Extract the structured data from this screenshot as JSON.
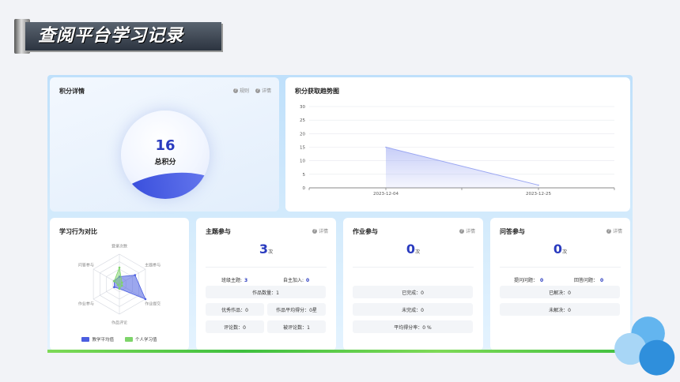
{
  "slide": {
    "title": "查阅平台学习记录"
  },
  "score_card": {
    "title": "积分详情",
    "rules_label": "规则",
    "details_label": "详情",
    "score": "16",
    "score_label": "总积分"
  },
  "trend_card": {
    "title": "积分获取趋势图"
  },
  "radar_card": {
    "title": "学习行为对比",
    "axes": [
      "登录次数",
      "主题参与",
      "作业提交",
      "作品评论",
      "作业参与",
      "问答参与"
    ],
    "legend": [
      {
        "name": "教学平均值",
        "color": "#4b5ee0"
      },
      {
        "name": "个人学习值",
        "color": "#7ed46a"
      }
    ],
    "colors": {
      "teach": "#4b5ee0",
      "personal": "#7ed46a"
    }
  },
  "topic_card": {
    "title": "主题参与",
    "details_label": "详情",
    "count": "3",
    "unit": "次",
    "stats": [
      {
        "label": "班级主题:",
        "value": "3"
      },
      {
        "label": "自主加入:",
        "value": "0"
      }
    ],
    "works_count": "作品数量：1",
    "pills": [
      "优秀作品：0",
      "作品平均得分：0星",
      "评论数：0",
      "被评论数：1"
    ]
  },
  "hw_card": {
    "title": "作业参与",
    "details_label": "详情",
    "count": "0",
    "unit": "次",
    "pills": [
      "已完成：0",
      "未完成：0",
      "平均得分率：0 %"
    ]
  },
  "qa_card": {
    "title": "问答参与",
    "details_label": "详情",
    "count": "0",
    "unit": "次",
    "stats": [
      {
        "label": "提问问题：",
        "value": "0"
      },
      {
        "label": "回答问题：",
        "value": "0"
      }
    ],
    "pills": [
      "已解决：0",
      "未解决：0"
    ]
  },
  "chart_data": {
    "type": "area",
    "title": "积分获取趋势图",
    "x": [
      "2023-12-04",
      "2023-12-25"
    ],
    "x_ticks": [
      "2023-12-04",
      "2023-12-25"
    ],
    "values": [
      15,
      1
    ],
    "yticks": [
      0,
      5,
      10,
      15,
      20,
      25,
      30
    ],
    "ylim": [
      0,
      30
    ],
    "grid": true,
    "color": "#9aa6f2"
  }
}
